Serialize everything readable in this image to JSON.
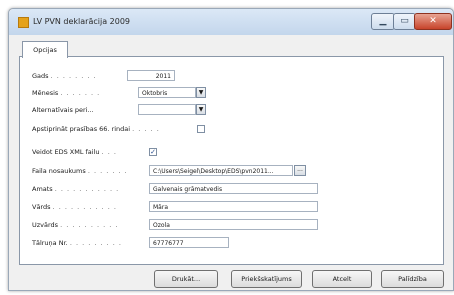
{
  "window": {
    "title": "LV PVN deklarācija 2009",
    "controls": {
      "minimize": "▁",
      "maximize": "▭",
      "close": "✕"
    }
  },
  "tabs": [
    {
      "label": "Opcijas"
    }
  ],
  "form": {
    "year": {
      "label": "Gads",
      "dots": ". . . . . . . .",
      "value": "2011"
    },
    "month": {
      "label": "Mēnesis",
      "dots": ". . . . . . .",
      "value": "Oktobris"
    },
    "alt_period": {
      "label": "Alternatīvais peri...",
      "value": ""
    },
    "confirm_rule": {
      "label": "Apstiprināt prasības 66. rindai",
      "dots": ". . . . .",
      "checked": false
    },
    "create_xml": {
      "label": "Veidot EDS XML failu",
      "dots": ". . .",
      "checked": true
    },
    "file_name": {
      "label": "Faila nosaukums",
      "dots": ". . . . . . .",
      "value": "C:\\Users\\Seigel\\Desktop\\EDS\\pvn2011...",
      "browse": "..."
    },
    "position": {
      "label": "Amats",
      "dots": ". . . . . . . . . . .",
      "value": "Galvenais grāmatvedis"
    },
    "first_name": {
      "label": "Vārds",
      "dots": ". . . . . . . . . . .",
      "value": "Māra"
    },
    "surname": {
      "label": "Uzvārds",
      "dots": ". . . . . . . . . .",
      "value": "Ozola"
    },
    "phone": {
      "label": "Tālruņa Nr.",
      "dots": ". . . . . . . . .",
      "value": "67776777"
    }
  },
  "buttons": {
    "print": "Drukāt...",
    "preview": "Priekšskatījums",
    "cancel": "Atcelt",
    "help": "Palīdzība"
  }
}
